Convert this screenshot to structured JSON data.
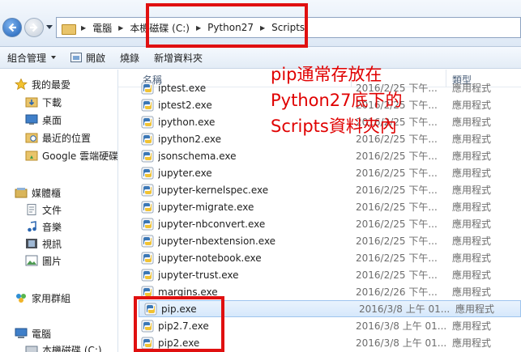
{
  "address_bar": {
    "crumbs": [
      "電腦",
      "本機磁碟 (C:)",
      "Python27",
      "Scripts"
    ]
  },
  "toolbar": {
    "organize_label": "組合管理",
    "open_label": "開啟",
    "burn_label": "燒錄",
    "new_folder_label": "新增資料夾"
  },
  "nav": {
    "favorites": "我的最愛",
    "downloads": "下載",
    "desktop": "桌面",
    "recent": "最近的位置",
    "google_drive": "Google 雲端硬碟",
    "libraries": "媒體櫃",
    "documents": "文件",
    "music": "音樂",
    "videos": "視訊",
    "pictures": "圖片",
    "homegroup": "家用群組",
    "computer": "電腦",
    "local_disk": "本機磁碟 (C:)"
  },
  "columns": {
    "name": "名稱",
    "type": "類型"
  },
  "files": [
    {
      "name": "iptest.exe",
      "date": "2016/2/25 下午...",
      "type": "應用程式"
    },
    {
      "name": "iptest2.exe",
      "date": "2016/2/25 下午...",
      "type": "應用程式"
    },
    {
      "name": "ipython.exe",
      "date": "2016/2/25 下午...",
      "type": "應用程式"
    },
    {
      "name": "ipython2.exe",
      "date": "2016/2/25 下午...",
      "type": "應用程式"
    },
    {
      "name": "jsonschema.exe",
      "date": "2016/2/25 下午...",
      "type": "應用程式"
    },
    {
      "name": "jupyter.exe",
      "date": "2016/2/25 下午...",
      "type": "應用程式"
    },
    {
      "name": "jupyter-kernelspec.exe",
      "date": "2016/2/25 下午...",
      "type": "應用程式"
    },
    {
      "name": "jupyter-migrate.exe",
      "date": "2016/2/25 下午...",
      "type": "應用程式"
    },
    {
      "name": "jupyter-nbconvert.exe",
      "date": "2016/2/25 下午...",
      "type": "應用程式"
    },
    {
      "name": "jupyter-nbextension.exe",
      "date": "2016/2/25 下午...",
      "type": "應用程式"
    },
    {
      "name": "jupyter-notebook.exe",
      "date": "2016/2/25 下午...",
      "type": "應用程式"
    },
    {
      "name": "jupyter-trust.exe",
      "date": "2016/2/25 下午...",
      "type": "應用程式"
    },
    {
      "name": "margins.exe",
      "date": "2016/2/26 下午...",
      "type": "應用程式"
    },
    {
      "name": "pip.exe",
      "date": "2016/3/8 上午 01...",
      "type": "應用程式",
      "selected": true
    },
    {
      "name": "pip2.7.exe",
      "date": "2016/3/8 上午 01...",
      "type": "應用程式"
    },
    {
      "name": "pip2.exe",
      "date": "2016/3/8 上午 01...",
      "type": "應用程式"
    }
  ],
  "annotation": {
    "line1": "pip通常存放在",
    "line2": "Python27底下的",
    "line3": "Scripts資料夾內"
  },
  "colors": {
    "annotation": "#e00000",
    "highlight_box": "#e01010",
    "selection": "#d6e8fb"
  }
}
